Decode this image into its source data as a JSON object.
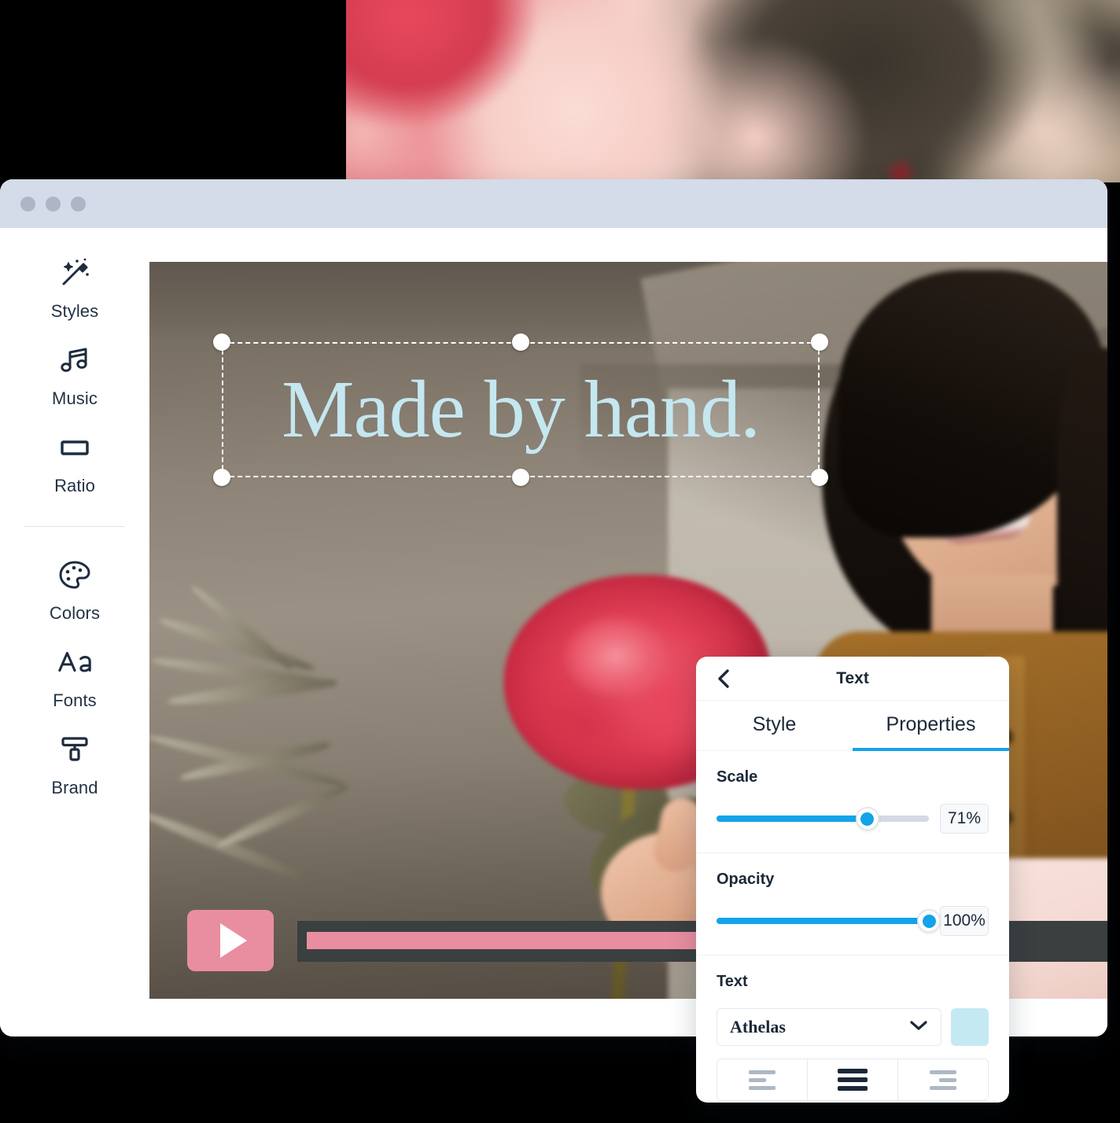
{
  "window": {
    "titlebar_dots": 3
  },
  "sidebar": {
    "items": [
      {
        "label": "Styles",
        "icon": "magic-wand-icon"
      },
      {
        "label": "Music",
        "icon": "music-note-icon"
      },
      {
        "label": "Ratio",
        "icon": "rectangle-icon"
      },
      {
        "label": "Colors",
        "icon": "palette-icon"
      },
      {
        "label": "Fonts",
        "icon": "font-aa-icon"
      },
      {
        "label": "Brand",
        "icon": "paint-roller-icon"
      }
    ],
    "divider_after_index": 2
  },
  "canvas": {
    "headline_text": "Made by hand.",
    "headline_color": "#c4e7f0",
    "selection_handles": 6,
    "play_button_color": "#e88ea0",
    "timeline_color": "#3a3f40",
    "timeline_fill_color": "#e88ea0",
    "timeline_progress_percent": 60
  },
  "panel": {
    "title": "Text",
    "back_icon": "chevron-left-icon",
    "tabs": [
      {
        "label": "Style",
        "active": false
      },
      {
        "label": "Properties",
        "active": true
      }
    ],
    "accent_color": "#13a3e8",
    "sections": {
      "scale": {
        "label": "Scale",
        "value": "71%",
        "percent": 71
      },
      "opacity": {
        "label": "Opacity",
        "value": "100%",
        "percent": 100
      },
      "text": {
        "label": "Text",
        "font_name": "Athelas",
        "dropdown_icon": "chevron-down-icon",
        "color_swatch": "#c4e9f3",
        "alignment": [
          {
            "name": "align-left",
            "active": false
          },
          {
            "name": "align-center",
            "active": true
          },
          {
            "name": "align-right",
            "active": false
          }
        ]
      }
    }
  }
}
